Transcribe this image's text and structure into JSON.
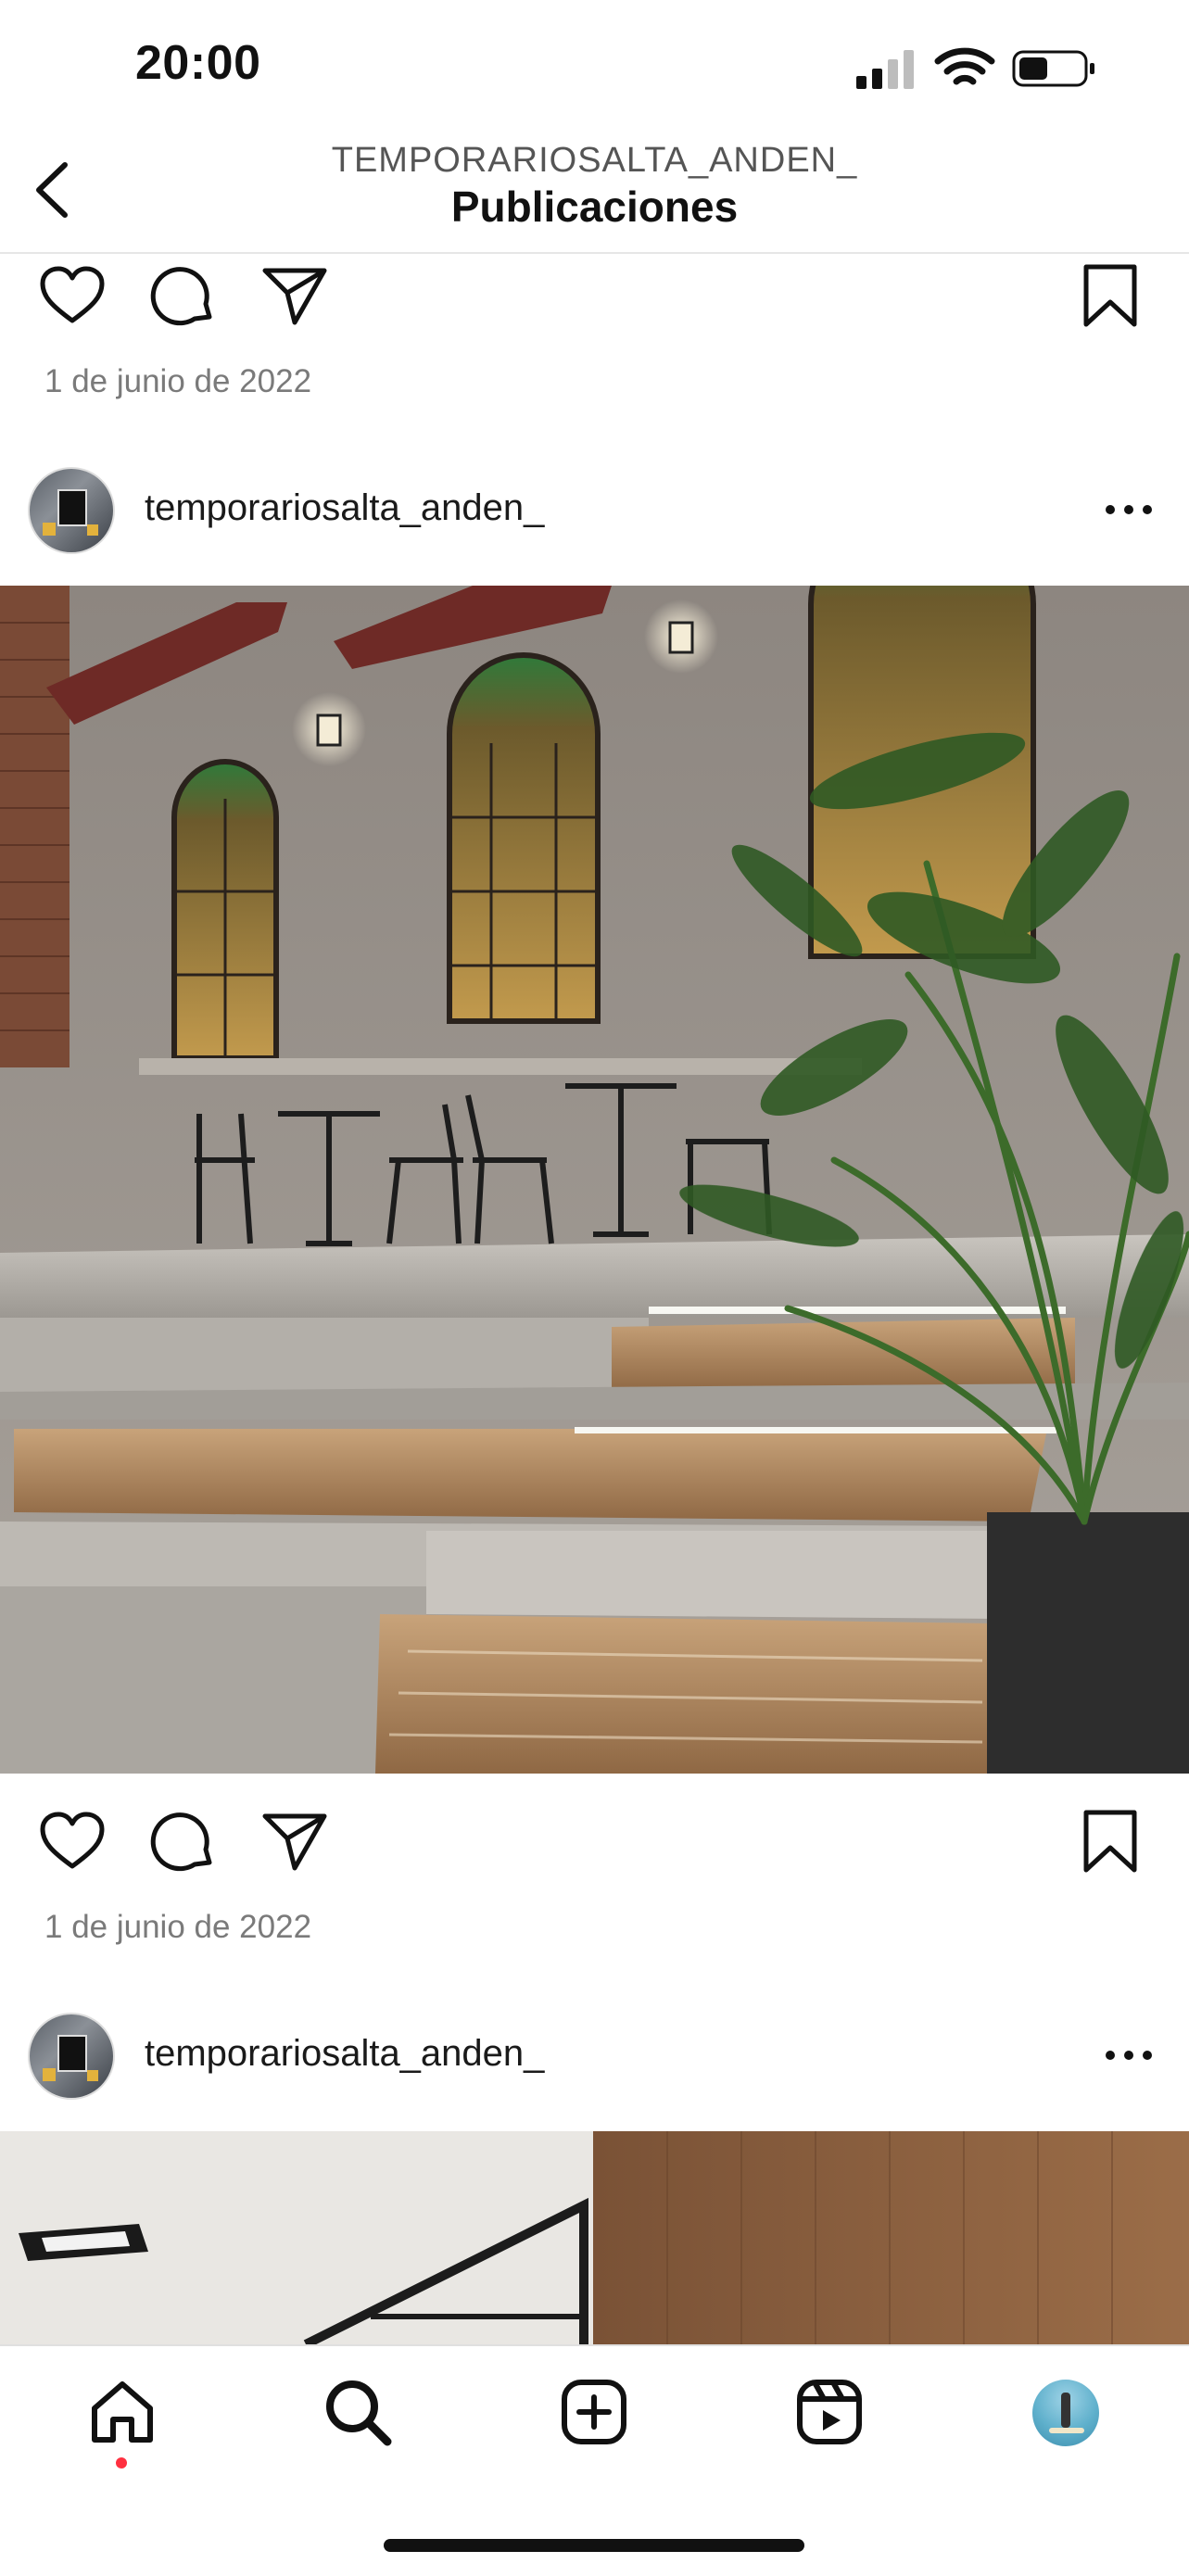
{
  "status_bar": {
    "time": "20:00"
  },
  "header": {
    "account": "TEMPORARIOSALTA_ANDEN_",
    "title": "Publicaciones"
  },
  "posts": [
    {
      "date": "1 de junio de 2022"
    },
    {
      "username": "temporariosalta_anden_",
      "date": "1 de junio de 2022"
    },
    {
      "username": "temporariosalta_anden_"
    }
  ],
  "colors": {
    "text": "#111111",
    "muted": "#7a7a7a",
    "notification": "#ff3040"
  },
  "icons": {
    "back": "chevron-left-icon",
    "like": "heart-icon",
    "comment": "comment-bubble-icon",
    "share": "paper-plane-icon",
    "save": "bookmark-icon",
    "more": "ellipsis-icon",
    "nav": [
      "home-icon",
      "search-icon",
      "create-post-icon",
      "reels-icon",
      "profile-avatar"
    ]
  }
}
